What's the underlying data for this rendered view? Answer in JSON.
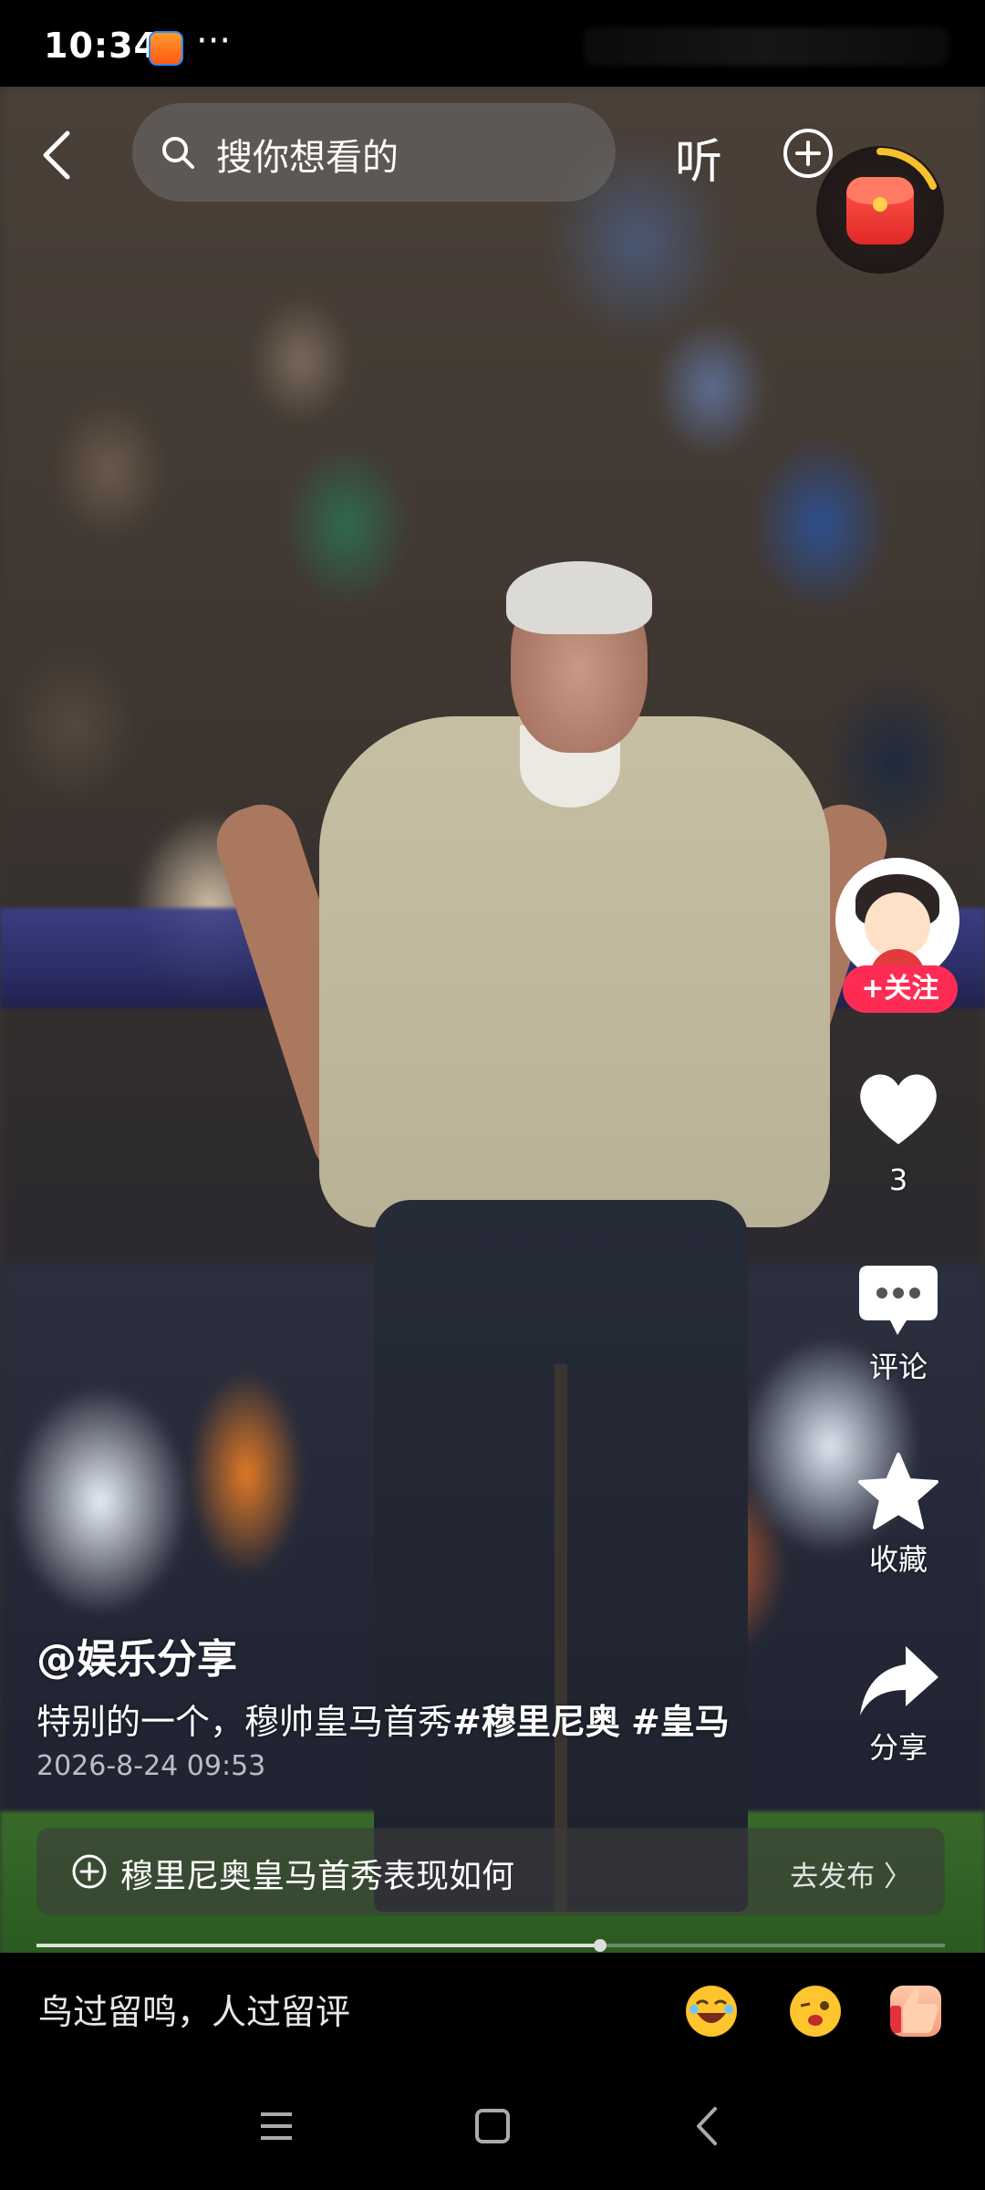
{
  "status_bar": {
    "time": "10:34",
    "more": "···"
  },
  "top_bar": {
    "search_placeholder": "搜你想看的",
    "listen_label": "听"
  },
  "right_actions": {
    "follow_label": "+关注",
    "like_count": "3",
    "comment_label": "评论",
    "favorite_label": "收藏",
    "share_label": "分享"
  },
  "post": {
    "author": "@娱乐分享",
    "caption_text": "特别的一个，穆帅皇马首秀",
    "hashtags": [
      "#穆里尼奥",
      "#皇马"
    ],
    "date": "2026-8-24 09:53"
  },
  "topic_bar": {
    "text": "穆里尼奥皇马首秀表现如何",
    "action": "去发布 〉"
  },
  "video_progress": 0.62,
  "comment_bar": {
    "placeholder": "鸟过留鸣，人过留评"
  },
  "colors": {
    "follow_button": "#fe2c55",
    "background": "#000000",
    "red_packet": "#e12828"
  },
  "icons": [
    "back-icon",
    "search-icon",
    "plus-circle-icon",
    "red-packet-icon",
    "heart-icon",
    "comment-icon",
    "star-icon",
    "share-icon",
    "laugh-emoji-icon",
    "wink-emoji-icon",
    "thumbs-up-emoji-icon",
    "menu-icon",
    "home-icon",
    "back-nav-icon"
  ]
}
